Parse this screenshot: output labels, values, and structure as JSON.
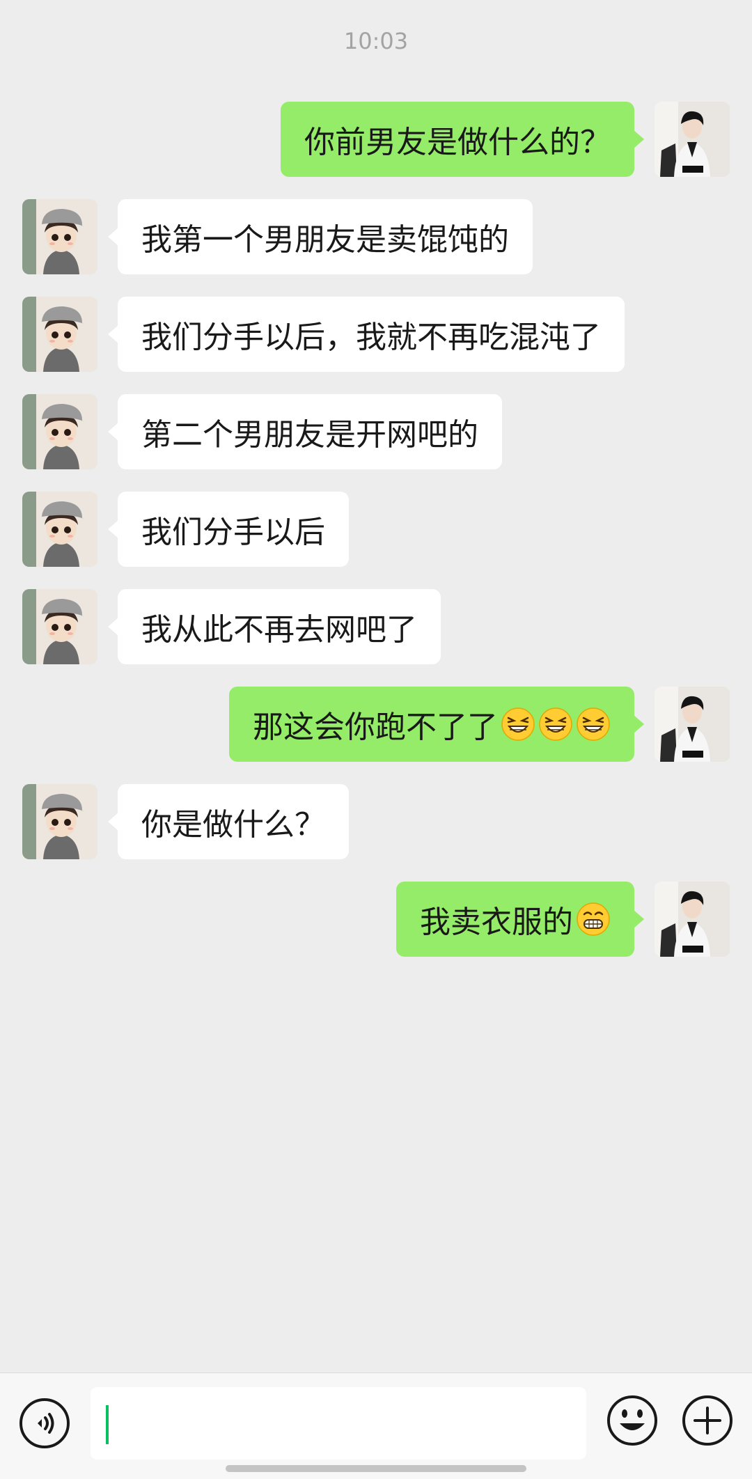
{
  "chat": {
    "timestamp": "10:03",
    "messages": [
      {
        "side": "right",
        "text": "你前男友是做什么的？",
        "emoji_count": 0
      },
      {
        "side": "left",
        "text": "我第一个男朋友是卖馄饨的",
        "emoji_count": 0
      },
      {
        "side": "left",
        "text": "我们分手以后，我就不再吃混沌了",
        "emoji_count": 0
      },
      {
        "side": "left",
        "text": "第二个男朋友是开网吧的",
        "emoji_count": 0
      },
      {
        "side": "left",
        "text": "我们分手以后",
        "emoji_count": 0
      },
      {
        "side": "left",
        "text": "我从此不再去网吧了",
        "emoji_count": 0
      },
      {
        "side": "right",
        "text": "那这会你跑不了了",
        "emoji": "grin-squint-emoji",
        "emoji_count": 3
      },
      {
        "side": "left",
        "text": "你是做什么？",
        "emoji_count": 0
      },
      {
        "side": "right",
        "text": "我卖衣服的",
        "emoji": "grimace-emoji",
        "emoji_count": 1
      }
    ]
  },
  "input_bar": {
    "value": "",
    "icons": [
      "voice-icon",
      "emoji-icon",
      "plus-icon"
    ]
  },
  "colors": {
    "background": "#ededed",
    "bubble_sent": "#95ec69",
    "bubble_received": "#ffffff",
    "caret": "#07c160"
  }
}
